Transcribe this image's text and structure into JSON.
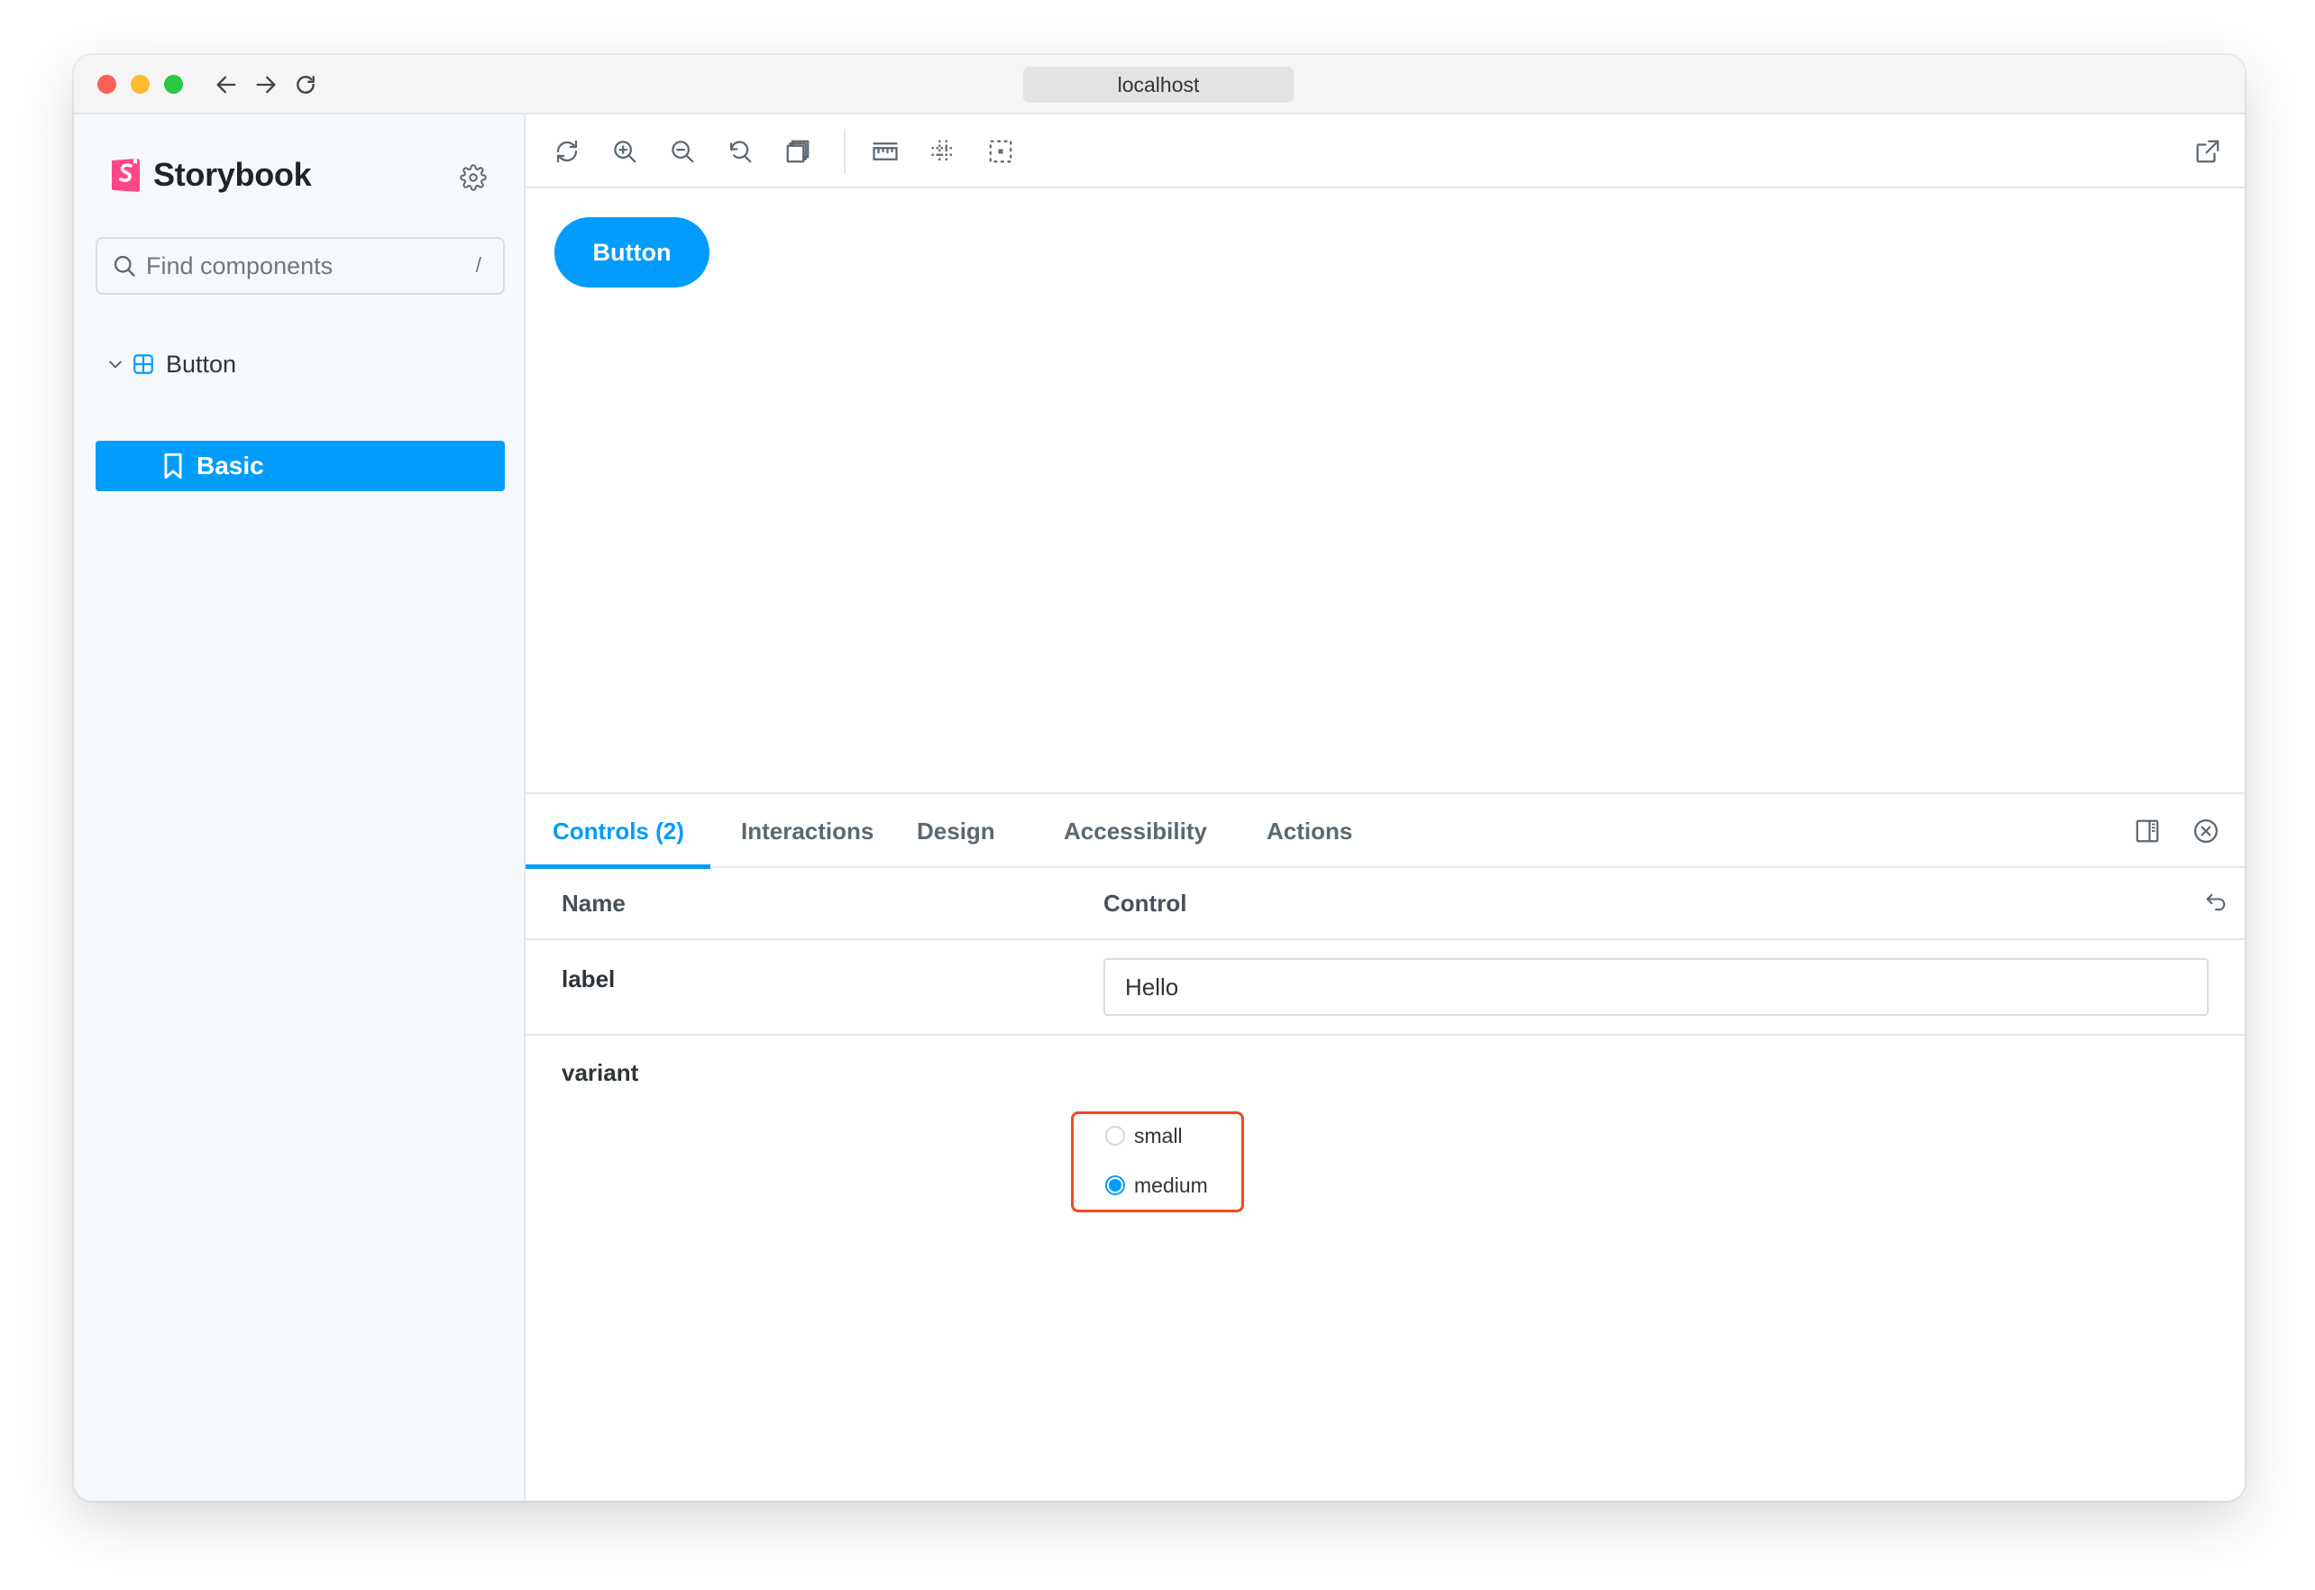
{
  "browser": {
    "url": "localhost",
    "traffic_lights": [
      "close",
      "minimize",
      "zoom"
    ],
    "nav": [
      "back-icon",
      "forward-icon",
      "reload-icon"
    ]
  },
  "sidebar": {
    "brand": "Storybook",
    "search": {
      "placeholder": "Find components",
      "shortcut": "/"
    },
    "tree": {
      "group_label": "Button",
      "selected_story": "Basic"
    }
  },
  "toolbar": {
    "icons": [
      "remount-icon",
      "zoom-in-icon",
      "zoom-out-icon",
      "reset-zoom-icon",
      "background-icon",
      "measure-icon",
      "grid-icon",
      "outline-icon",
      "open-new-tab-icon"
    ]
  },
  "preview": {
    "button_label": "Button"
  },
  "addons": {
    "tabs": [
      "Controls (2)",
      "Interactions",
      "Design",
      "Accessibility",
      "Actions"
    ],
    "active_tab": "Controls (2)",
    "table": {
      "col_name": "Name",
      "col_control": "Control",
      "rows": [
        {
          "name": "label",
          "value": "Hello"
        },
        {
          "name": "variant",
          "options": [
            "small",
            "medium"
          ],
          "selected": "medium"
        }
      ]
    }
  },
  "colors": {
    "accent": "#029cfd",
    "highlight": "#f5471d",
    "storybook_pink": "#ff4785"
  }
}
